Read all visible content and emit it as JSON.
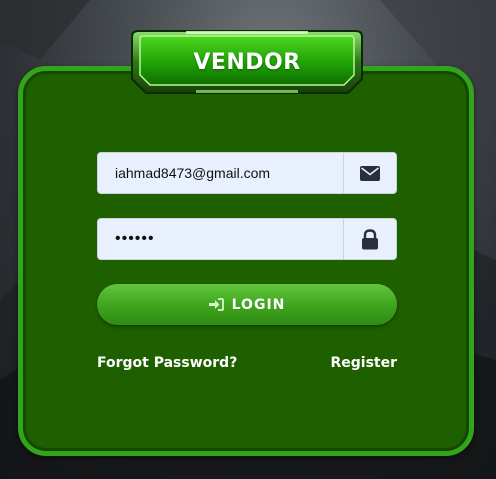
{
  "header": {
    "title": "VENDOR"
  },
  "form": {
    "email": {
      "value": "iahmad8473@gmail.com",
      "icon": "envelope-icon"
    },
    "password": {
      "value": "••••••",
      "icon": "lock-icon"
    },
    "login_button": {
      "label": "LOGIN",
      "icon": "sign-in-icon"
    }
  },
  "links": {
    "forgot_password": "Forgot Password?",
    "register": "Register"
  },
  "colors": {
    "card_background": "#1e5f00",
    "card_border": "#33a51a",
    "button_green": "#3ea31d",
    "input_background": "#e8f0fe"
  }
}
